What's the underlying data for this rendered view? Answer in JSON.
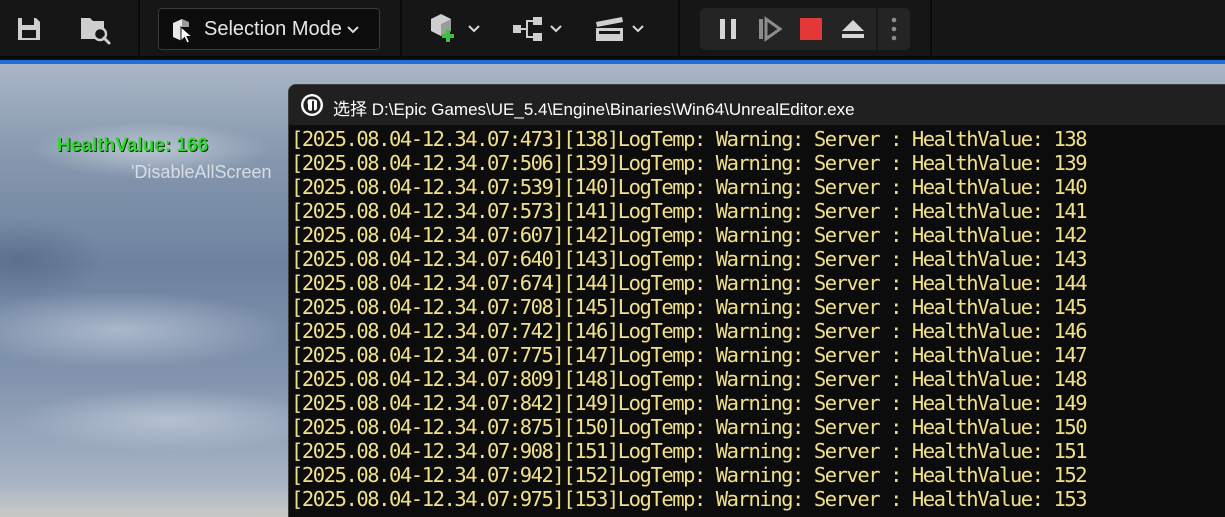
{
  "toolbar": {
    "icons": {
      "save": "save-icon",
      "browse": "content-browser-icon",
      "mode": "selection-mode-icon",
      "add": "add-actor-icon",
      "blueprint": "blueprint-icon",
      "cinematics": "cinematics-icon"
    },
    "mode_label": "Selection Mode",
    "colors": {
      "stop": "#e53939",
      "add_plus": "#3fbf3f",
      "accent": "#1f6fd6"
    }
  },
  "viewport": {
    "health_text": "HealthValue: 166",
    "disable_text": "'DisableAllScreen",
    "colors": {
      "health_text": "#33d633"
    }
  },
  "console": {
    "title": "选择 D:\\Epic Games\\UE_5.4\\Engine\\Binaries\\Win64\\UnrealEditor.exe",
    "colors": {
      "warning_text": "#f1e08a",
      "background": "#0c0c0c"
    },
    "lines": [
      {
        "prefix": "[2025.08.04-12.34.07:473][138]",
        "message": "LogTemp: Warning: Server : HealthValue: 138"
      },
      {
        "prefix": "[2025.08.04-12.34.07:506][139]",
        "message": "LogTemp: Warning: Server : HealthValue: 139"
      },
      {
        "prefix": "[2025.08.04-12.34.07:539][140]",
        "message": "LogTemp: Warning: Server : HealthValue: 140"
      },
      {
        "prefix": "[2025.08.04-12.34.07:573][141]",
        "message": "LogTemp: Warning: Server : HealthValue: 141"
      },
      {
        "prefix": "[2025.08.04-12.34.07:607][142]",
        "message": "LogTemp: Warning: Server : HealthValue: 142"
      },
      {
        "prefix": "[2025.08.04-12.34.07:640][143]",
        "message": "LogTemp: Warning: Server : HealthValue: 143"
      },
      {
        "prefix": "[2025.08.04-12.34.07:674][144]",
        "message": "LogTemp: Warning: Server : HealthValue: 144"
      },
      {
        "prefix": "[2025.08.04-12.34.07:708][145]",
        "message": "LogTemp: Warning: Server : HealthValue: 145"
      },
      {
        "prefix": "[2025.08.04-12.34.07:742][146]",
        "message": "LogTemp: Warning: Server : HealthValue: 146"
      },
      {
        "prefix": "[2025.08.04-12.34.07:775][147]",
        "message": "LogTemp: Warning: Server : HealthValue: 147"
      },
      {
        "prefix": "[2025.08.04-12.34.07:809][148]",
        "message": "LogTemp: Warning: Server : HealthValue: 148"
      },
      {
        "prefix": "[2025.08.04-12.34.07:842][149]",
        "message": "LogTemp: Warning: Server : HealthValue: 149"
      },
      {
        "prefix": "[2025.08.04-12.34.07:875][150]",
        "message": "LogTemp: Warning: Server : HealthValue: 150"
      },
      {
        "prefix": "[2025.08.04-12.34.07:908][151]",
        "message": "LogTemp: Warning: Server : HealthValue: 151"
      },
      {
        "prefix": "[2025.08.04-12.34.07:942][152]",
        "message": "LogTemp: Warning: Server : HealthValue: 152"
      },
      {
        "prefix": "[2025.08.04-12.34.07:975][153]",
        "message": "LogTemp: Warning: Server : HealthValue: 153"
      }
    ]
  }
}
